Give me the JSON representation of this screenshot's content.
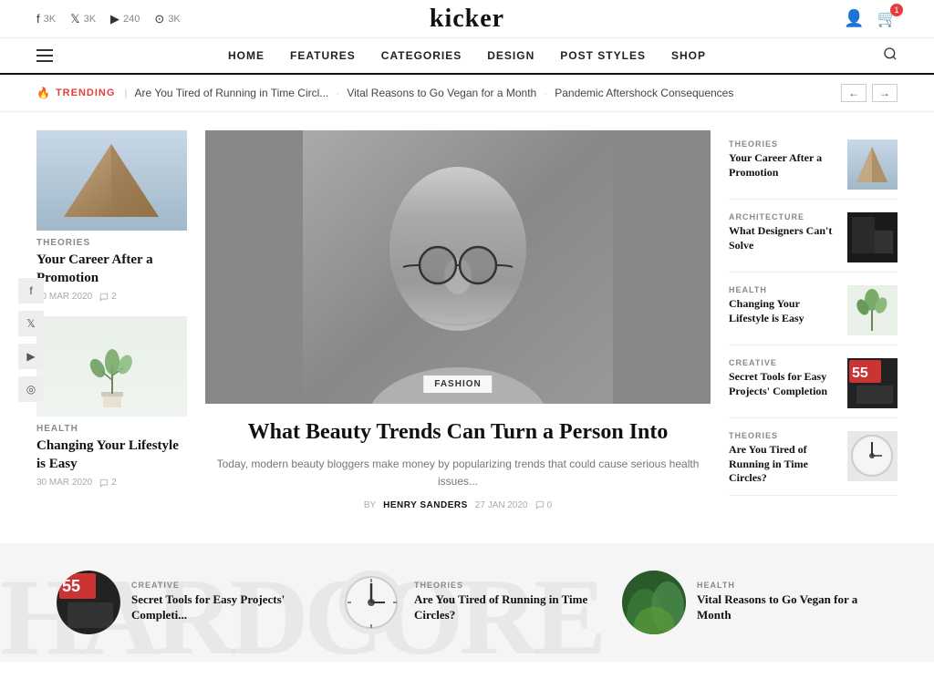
{
  "site": {
    "logo": "kicker"
  },
  "social_bar": {
    "items": [
      {
        "icon": "f",
        "count": "3K",
        "platform": "facebook"
      },
      {
        "icon": "𝕏",
        "count": "3K",
        "platform": "twitter"
      },
      {
        "icon": "▶",
        "count": "240",
        "platform": "youtube"
      },
      {
        "icon": "⊙",
        "count": "3K",
        "platform": "instagram"
      }
    ],
    "user_icon": "👤",
    "cart_icon": "🛒",
    "cart_count": "1"
  },
  "nav": {
    "menu_icon": "menu",
    "links": [
      "HOME",
      "FEATURES",
      "CATEGORIES",
      "DESIGN",
      "POST STYLES",
      "SHOP"
    ],
    "search_icon": "search"
  },
  "trending": {
    "label": "TRENDING",
    "items": [
      "Are You Tired of Running in Time Circl...",
      "Vital Reasons to Go Vegan for a Month",
      "Pandemic Aftershock Consequences"
    ],
    "prev_label": "←",
    "next_label": "→"
  },
  "left_articles": [
    {
      "category": "THEORIES",
      "title": "Your Career After a Promotion",
      "date": "30 MAR 2020",
      "comments": "2",
      "img_class": "img-architecture"
    },
    {
      "category": "HEALTH",
      "title": "Changing Your Lifestyle is Easy",
      "date": "30 MAR 2020",
      "comments": "2",
      "img_class": "img-plant"
    }
  ],
  "featured": {
    "category": "FASHION",
    "title": "What Beauty Trends Can Turn a Person Into",
    "excerpt": "Today, modern beauty bloggers make money by popularizing trends that could cause serious health issues...",
    "author_label": "BY",
    "author": "HENRY SANDERS",
    "date": "27 JAN 2020",
    "comments": "0"
  },
  "right_articles": [
    {
      "category": "THEORIES",
      "title": "Your Career After a Promotion",
      "img_class": "img-architecture"
    },
    {
      "category": "ARCHITECTURE",
      "title": "What Designers Can't Solve",
      "img_class": "img-dark"
    },
    {
      "category": "HEALTH",
      "title": "Changing Your Lifestyle is Easy",
      "img_class": "img-leaf"
    },
    {
      "category": "CREATIVE",
      "title": "Secret Tools for Easy Projects' Completion",
      "img_class": "img-tools"
    },
    {
      "category": "THEORIES",
      "title": "Are You Tired of Running in Time Circles?",
      "img_class": "img-clock"
    }
  ],
  "float_social": [
    {
      "icon": "f",
      "platform": "facebook"
    },
    {
      "icon": "𝕏",
      "platform": "twitter"
    },
    {
      "icon": "▶",
      "platform": "youtube"
    },
    {
      "icon": "◎",
      "platform": "instagram"
    }
  ],
  "bottom_articles": [
    {
      "category": "CREATIVE",
      "title": "Secret Tools for Easy Projects' Completi...",
      "img_class": "img-tools"
    },
    {
      "category": "THEORIES",
      "title": "Are You Tired of Running in Time Circles?",
      "img_class": "img-clock"
    },
    {
      "category": "HEALTH",
      "title": "Vital Reasons to Go Vegan for a Month",
      "img_class": "img-green"
    }
  ],
  "bottom_bg_text": "HARDCORE"
}
